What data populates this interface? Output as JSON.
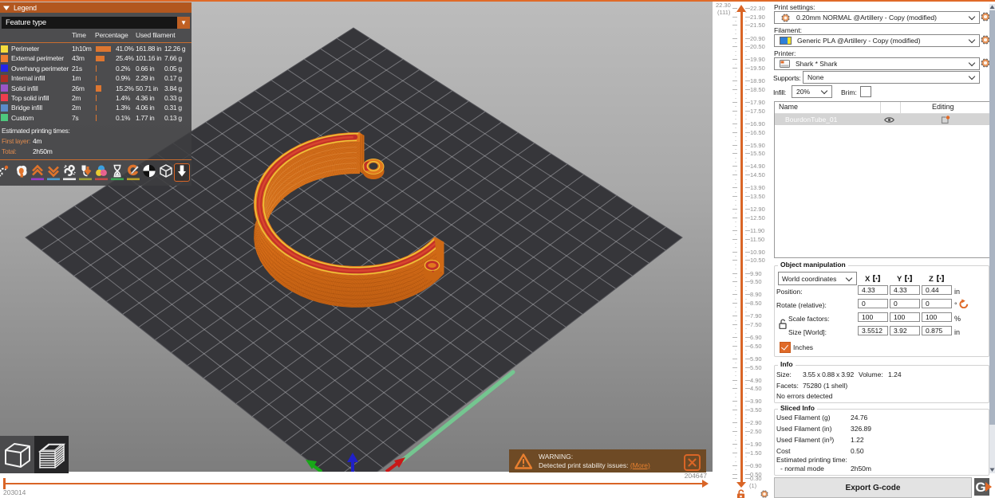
{
  "accent": "#d96526",
  "legend": {
    "title": "Legend",
    "feature_combo_value": "Feature type",
    "columns": {
      "time": "Time",
      "percentage": "Percentage",
      "used_filament": "Used filament"
    },
    "rows": [
      {
        "color": "#f5dc3c",
        "label": "Perimeter",
        "time": "1h10m",
        "pct": 41.0,
        "pct_label": "41.0%",
        "length": "161.88 in",
        "weight": "12.26 g"
      },
      {
        "color": "#ee7e31",
        "label": "External perimeter",
        "time": "43m",
        "pct": 25.4,
        "pct_label": "25.4%",
        "length": "101.16 in",
        "weight": "7.66 g"
      },
      {
        "color": "#2525e8",
        "label": "Overhang perimeter",
        "time": "21s",
        "pct": 0.2,
        "pct_label": "0.2%",
        "length": "0.66 in",
        "weight": "0.05 g"
      },
      {
        "color": "#ae2f26",
        "label": "Internal infill",
        "time": "1m",
        "pct": 0.9,
        "pct_label": "0.9%",
        "length": "2.29 in",
        "weight": "0.17 g"
      },
      {
        "color": "#9a56c8",
        "label": "Solid infill",
        "time": "26m",
        "pct": 15.2,
        "pct_label": "15.2%",
        "length": "50.71 in",
        "weight": "3.84 g"
      },
      {
        "color": "#ee3e4e",
        "label": "Top solid infill",
        "time": "2m",
        "pct": 1.4,
        "pct_label": "1.4%",
        "length": "4.36 in",
        "weight": "0.33 g"
      },
      {
        "color": "#5b8cc8",
        "label": "Bridge infill",
        "time": "2m",
        "pct": 1.3,
        "pct_label": "1.3%",
        "length": "4.06 in",
        "weight": "0.31 g"
      },
      {
        "color": "#4ec87e",
        "label": "Custom",
        "time": "7s",
        "pct": 0.1,
        "pct_label": "0.1%",
        "length": "1.77 in",
        "weight": "0.13 g"
      }
    ],
    "estimated_title": "Estimated printing times:",
    "first_layer_label": "First layer:",
    "first_layer_value": "4m",
    "total_label": "Total:",
    "total_value": "2h50m",
    "toolbar_icons": [
      {
        "name": "travel-icon",
        "underline": ""
      },
      {
        "name": "wipe-icon",
        "underline": ""
      },
      {
        "name": "retractions-icon",
        "underline": "#9a3cc8"
      },
      {
        "name": "deretractions-icon",
        "underline": "#4e9ccc"
      },
      {
        "name": "seams-icon",
        "underline": "#e8e8e8"
      },
      {
        "name": "print-pauses-icon",
        "underline": "#9aa03a"
      },
      {
        "name": "color-changes-icon",
        "underline": "#c04848"
      },
      {
        "name": "pause-prints-icon",
        "underline": "#3aa353"
      },
      {
        "name": "custom-gcode-icon",
        "underline": "#b8a029"
      },
      {
        "name": "shells-icon",
        "underline": ""
      },
      {
        "name": "box-icon",
        "underline": ""
      },
      {
        "name": "tool-marker-icon",
        "underline": ""
      }
    ]
  },
  "warning": {
    "title": "WARNING:",
    "message": "Detected print stability issues:",
    "link": "(More)"
  },
  "hslider": {
    "min_label": "203014",
    "max_label": "204647"
  },
  "vslider": {
    "top_value": "22.30",
    "top_layer": "(111)",
    "bottom_layer": "(1)",
    "max": 22.3,
    "min": 0.3,
    "step": 0.2,
    "tick_labels": [
      "22.30",
      "21.90",
      "21.50",
      "20.90",
      "20.50",
      "19.90",
      "19.50",
      "18.90",
      "18.50",
      "17.90",
      "17.50",
      "16.90",
      "16.50",
      "15.90",
      "15.50",
      "14.90",
      "14.50",
      "13.90",
      "13.50",
      "12.90",
      "12.50",
      "11.90",
      "11.50",
      "10.90",
      "10.50",
      "9.90",
      "9.50",
      "8.90",
      "8.50",
      "7.90",
      "7.50",
      "6.90",
      "6.50",
      "5.90",
      "5.50",
      "4.90",
      "4.50",
      "3.90",
      "3.50",
      "2.90",
      "2.50",
      "1.90",
      "1.50",
      "0.90",
      "0.50",
      "0.30"
    ]
  },
  "panel": {
    "print_settings_label": "Print settings:",
    "print_settings_value": "0.20mm NORMAL @Artillery - Copy (modified)",
    "filament_label": "Filament:",
    "filament_value": "Generic PLA @Artillery - Copy (modified)",
    "printer_label": "Printer:",
    "printer_value": "Shark * Shark",
    "supports_label": "Supports:",
    "supports_value": "None",
    "infill_label": "Infill:",
    "infill_value": "20%",
    "brim_label": "Brim:",
    "objects": {
      "name_header": "Name",
      "editing_header": "Editing",
      "row_name": "BourdonTube_01"
    },
    "manipulation": {
      "title": "Object manipulation",
      "coords_value": "World coordinates",
      "axes": [
        "X",
        "Y",
        "Z"
      ],
      "rows": [
        {
          "label": "Position:",
          "values": [
            "4.33",
            "4.33",
            "0.44"
          ],
          "unit": "in"
        },
        {
          "label": "Rotate (relative):",
          "values": [
            "0",
            "0",
            "0"
          ],
          "unit": "°"
        },
        {
          "label": "Scale factors:",
          "values": [
            "100",
            "100",
            "100"
          ],
          "unit": "%"
        },
        {
          "label": "Size [World]:",
          "values": [
            "3.5512",
            "3.92",
            "0.875"
          ],
          "unit": "in"
        }
      ],
      "inches_label": "Inches"
    },
    "info": {
      "title": "Info",
      "size_label": "Size:",
      "size_value": "3.55 x 0.88 x 3.92",
      "volume_label": "Volume:",
      "volume_value": "1.24",
      "facets_label": "Facets:",
      "facets_value": "75280 (1 shell)",
      "errors_value": "No errors detected"
    },
    "sliced": {
      "title": "Sliced Info",
      "rows": [
        {
          "label": "Used Filament (g)",
          "value": "24.76"
        },
        {
          "label": "Used Filament (in)",
          "value": "326.89"
        },
        {
          "label": "Used Filament (in³)",
          "value": "1.22"
        },
        {
          "label": "Cost",
          "value": "0.50"
        }
      ],
      "time_label": "Estimated printing time:",
      "mode_label": "- normal mode",
      "mode_value": "2h50m"
    },
    "export_button": "Export G-code",
    "gcode_badge": "G"
  }
}
